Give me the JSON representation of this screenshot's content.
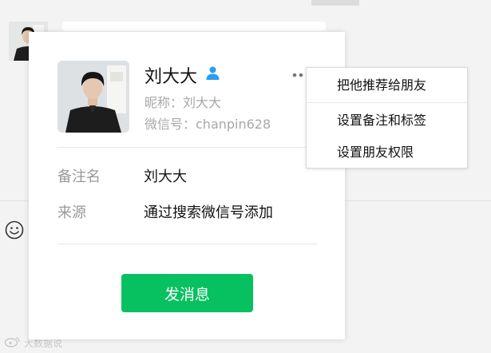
{
  "card": {
    "display_name": "刘大大",
    "nickname": "昵称：刘大大",
    "wechat_id": "微信号：chanpin628",
    "fields": [
      {
        "label": "备注名",
        "value": "刘大大"
      },
      {
        "label": "来源",
        "value": "通过搜索微信号添加"
      }
    ],
    "send_button": "发消息"
  },
  "menu": {
    "items": [
      "把他推荐给朋友",
      "设置备注和标签",
      "设置朋友权限"
    ]
  },
  "watermark": "大数据说",
  "icons": {
    "contact": "contact-person-icon",
    "more": "more-dots-icon",
    "emoji": "emoji-icon",
    "watermark_logo": "weibo-logo-icon"
  },
  "colors": {
    "accent_green": "#07c160",
    "contact_icon_blue": "#2a9df4",
    "muted_text": "#a8a8a8"
  }
}
